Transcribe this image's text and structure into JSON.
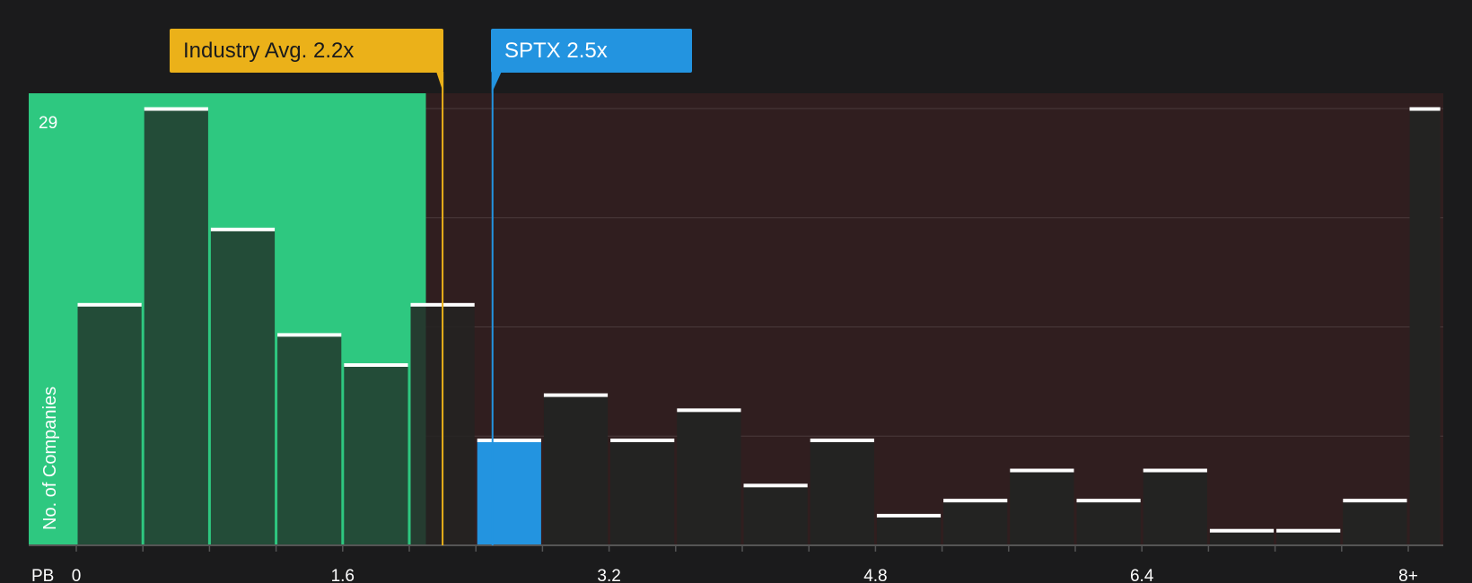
{
  "chart_data": {
    "type": "bar",
    "x_axis_label": "PB",
    "y_axis_label": "No. of Companies",
    "y_max_label": "29",
    "ylim": [
      0,
      29
    ],
    "xlim": [
      -0.28,
      8.2
    ],
    "x_ticks": [
      {
        "value": 0,
        "label": "0"
      },
      {
        "value": 1.6,
        "label": "1.6"
      },
      {
        "value": 3.2,
        "label": "3.2"
      },
      {
        "value": 4.8,
        "label": "4.8"
      },
      {
        "value": 6.4,
        "label": "6.4"
      },
      {
        "value": 8,
        "label": "8+"
      }
    ],
    "bins": [
      {
        "start": 0.0,
        "end": 0.4,
        "count": 16
      },
      {
        "start": 0.4,
        "end": 0.8,
        "count": 29
      },
      {
        "start": 0.8,
        "end": 1.2,
        "count": 21
      },
      {
        "start": 1.2,
        "end": 1.6,
        "count": 14
      },
      {
        "start": 1.6,
        "end": 2.0,
        "count": 12
      },
      {
        "start": 2.0,
        "end": 2.4,
        "count": 16
      },
      {
        "start": 2.4,
        "end": 2.8,
        "count": 7
      },
      {
        "start": 2.8,
        "end": 3.2,
        "count": 10
      },
      {
        "start": 3.2,
        "end": 3.6,
        "count": 7
      },
      {
        "start": 3.6,
        "end": 4.0,
        "count": 9
      },
      {
        "start": 4.0,
        "end": 4.4,
        "count": 4
      },
      {
        "start": 4.4,
        "end": 4.8,
        "count": 7
      },
      {
        "start": 4.8,
        "end": 5.2,
        "count": 2
      },
      {
        "start": 5.2,
        "end": 5.6,
        "count": 3
      },
      {
        "start": 5.6,
        "end": 6.0,
        "count": 5
      },
      {
        "start": 6.0,
        "end": 6.4,
        "count": 3
      },
      {
        "start": 6.4,
        "end": 6.8,
        "count": 5
      },
      {
        "start": 6.8,
        "end": 7.2,
        "count": 1
      },
      {
        "start": 7.2,
        "end": 7.6,
        "count": 1
      },
      {
        "start": 7.6,
        "end": 8.0,
        "count": 3
      },
      {
        "start": 8.0,
        "end": 8.2,
        "count": 29
      }
    ],
    "highlight_bin_index": 6,
    "industry_avg": {
      "label": "Industry Avg. 2.2x",
      "value": 2.2
    },
    "company": {
      "label": "SPTX 2.5x",
      "value": 2.5
    },
    "good_zone_end": 2.1,
    "grid": true,
    "colors": {
      "background": "#1b1b1c",
      "good_zone": "#2ec880",
      "bad_zone": "#301e1f",
      "bar": "#232322",
      "bar_in_good_zone": "#234c38",
      "bar_top": "#ffffff",
      "highlight_bar": "#2394e0",
      "industry": "#ebb119",
      "company": "#2394e0",
      "text": "#ffffff",
      "grid": "#4a3a3b",
      "axis": "#555555"
    }
  }
}
